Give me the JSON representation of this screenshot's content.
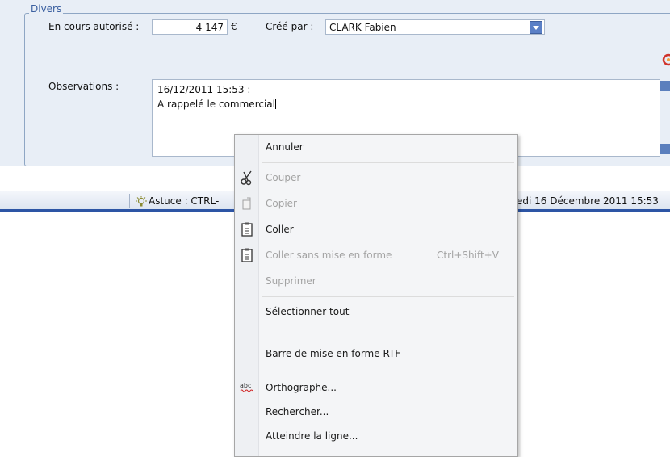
{
  "form": {
    "legend": "Divers",
    "encours_label": "En cours autorisé :",
    "encours_value": "4 147",
    "currency": "€",
    "cree_par_label": "Créé par :",
    "cree_par_value": "CLARK Fabien",
    "observations_label": "Observations :",
    "observations_line1": "16/12/2011  15:53 :",
    "observations_line2": "A rappelé le commercial"
  },
  "status_bar": {
    "tip": "Astuce : CTRL-",
    "date": "edi 16 Décembre 2011 15:53"
  },
  "context_menu": {
    "items": [
      {
        "label": "Annuler",
        "enabled": true
      },
      {
        "label": "Couper",
        "enabled": false,
        "icon": "scissors-icon"
      },
      {
        "label": "Copier",
        "enabled": false,
        "icon": "copy-icon"
      },
      {
        "label": "Coller",
        "enabled": true,
        "icon": "paste-icon"
      },
      {
        "label": "Coller sans mise en forme",
        "enabled": false,
        "icon": "paste-plain-icon",
        "shortcut": "Ctrl+Shift+V"
      },
      {
        "label": "Supprimer",
        "enabled": false
      },
      {
        "label": "Sélectionner tout",
        "enabled": true
      },
      {
        "label": "Barre de mise en forme RTF",
        "enabled": true
      },
      {
        "label_first": "O",
        "label_rest": "rthographe...",
        "enabled": true,
        "icon": "spellcheck-icon"
      },
      {
        "label": "Rechercher...",
        "enabled": true
      },
      {
        "label": "Atteindre la ligne...",
        "enabled": true
      }
    ]
  },
  "colors": {
    "panel": "#e8eef6",
    "accent": "#5a7fc6",
    "statusbar_border": "#2d55a5",
    "disabled_text": "#a3a3a3"
  }
}
